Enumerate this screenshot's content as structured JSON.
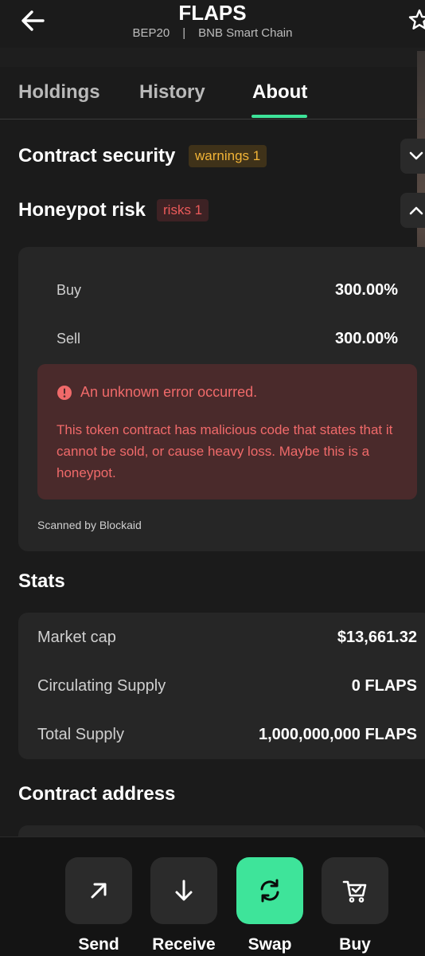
{
  "header": {
    "title": "FLAPS",
    "subtitle_left": "BEP20",
    "subtitle_sep": "|",
    "subtitle_right": "BNB Smart Chain",
    "back_icon": "arrow-left-icon",
    "star_icon": "star-icon"
  },
  "tabs": [
    {
      "label": "Holdings"
    },
    {
      "label": "History"
    },
    {
      "label": "About"
    }
  ],
  "active_tab": "About",
  "contract_security": {
    "title": "Contract security",
    "badge": "warnings 1",
    "chevron": "chevron-down-icon"
  },
  "honeypot": {
    "title": "Honeypot risk",
    "badge": "risks 1",
    "chevron": "chevron-up-icon",
    "rows": [
      {
        "label": "Buy",
        "value": "300.00%"
      },
      {
        "label": "Sell",
        "value": "300.00%"
      }
    ],
    "error_title": "An unknown error occurred.",
    "error_body": "This token contract has malicious code that states that it cannot be sold, or cause heavy loss. Maybe this is a honeypot.",
    "scanned_by": "Scanned by Blockaid"
  },
  "stats": {
    "title": "Stats",
    "rows": [
      {
        "label": "Market cap",
        "value": "$13,661.32"
      },
      {
        "label": "Circulating Supply",
        "value": "0 FLAPS"
      },
      {
        "label": "Total Supply",
        "value": "1,000,000,000 FLAPS"
      }
    ]
  },
  "contract_address": {
    "title": "Contract address"
  },
  "actions": [
    {
      "label": "Send",
      "icon": "arrow-up-right-icon"
    },
    {
      "label": "Receive",
      "icon": "arrow-down-icon"
    },
    {
      "label": "Swap",
      "icon": "swap-icon"
    },
    {
      "label": "Buy",
      "icon": "cart-icon"
    }
  ],
  "colors": {
    "background": "#1b1b1b",
    "accent": "#3ee49a",
    "warning": "#f2b437",
    "danger": "#f06a6a"
  }
}
